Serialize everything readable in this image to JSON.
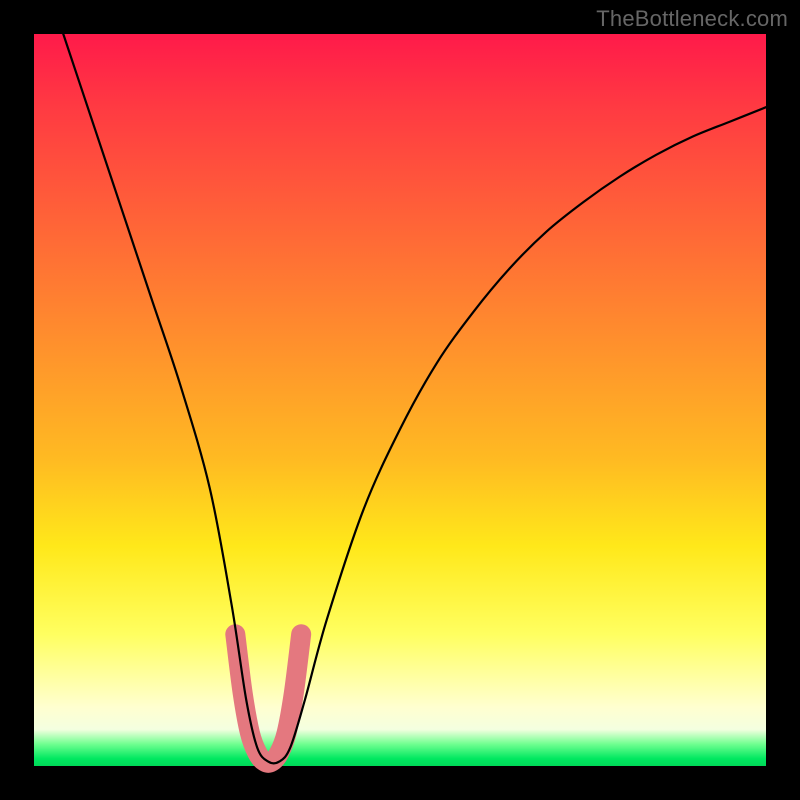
{
  "watermark": "TheBottleneck.com",
  "chart_data": {
    "type": "line",
    "title": "",
    "xlabel": "",
    "ylabel": "",
    "xlim": [
      0,
      100
    ],
    "ylim": [
      0,
      100
    ],
    "series": [
      {
        "name": "curve",
        "x": [
          4,
          8,
          12,
          16,
          20,
          24,
          27,
          29,
          30.5,
          32,
          33.5,
          35,
          37,
          40,
          45,
          50,
          55,
          60,
          65,
          70,
          75,
          80,
          85,
          90,
          95,
          100
        ],
        "y": [
          100,
          88,
          76,
          64,
          52,
          38,
          22,
          9,
          2.5,
          0.6,
          0.6,
          2.5,
          9,
          20,
          35,
          46,
          55,
          62,
          68,
          73,
          77,
          80.5,
          83.5,
          86,
          88,
          90
        ]
      },
      {
        "name": "highlight",
        "x": [
          27.5,
          28.5,
          29.5,
          30.5,
          31.5,
          32.5,
          33.5,
          34.5,
          35.5,
          36.5
        ],
        "y": [
          18,
          10,
          4.5,
          1.8,
          0.6,
          0.6,
          1.8,
          4.5,
          10,
          18
        ]
      }
    ],
    "colors": {
      "curve": "#000000",
      "highlight": "#e4787f",
      "gradient_top": "#ff1a4a",
      "gradient_bottom": "#00d858"
    }
  }
}
